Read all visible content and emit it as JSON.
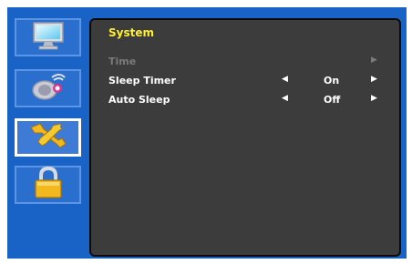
{
  "menu_icons": [
    {
      "name": "monitor-icon",
      "selected": false
    },
    {
      "name": "audio-icon",
      "selected": false
    },
    {
      "name": "tools-icon",
      "selected": true
    },
    {
      "name": "lock-icon",
      "selected": false
    }
  ],
  "panel": {
    "title": "System",
    "rows": [
      {
        "label": "Time",
        "left_arrow": "",
        "value": "",
        "right_arrow": "▶",
        "enabled": false
      },
      {
        "label": "Sleep Timer",
        "left_arrow": "◀",
        "value": "On",
        "right_arrow": "▶",
        "enabled": true
      },
      {
        "label": "Auto Sleep",
        "left_arrow": "◀",
        "value": "Off",
        "right_arrow": "▶",
        "enabled": true
      }
    ]
  },
  "colors": {
    "frame": "#1a63c6",
    "panel": "#3c3c3c",
    "title": "#ffee33",
    "text": "#ffffff",
    "disabled": "#7a7a7a"
  }
}
